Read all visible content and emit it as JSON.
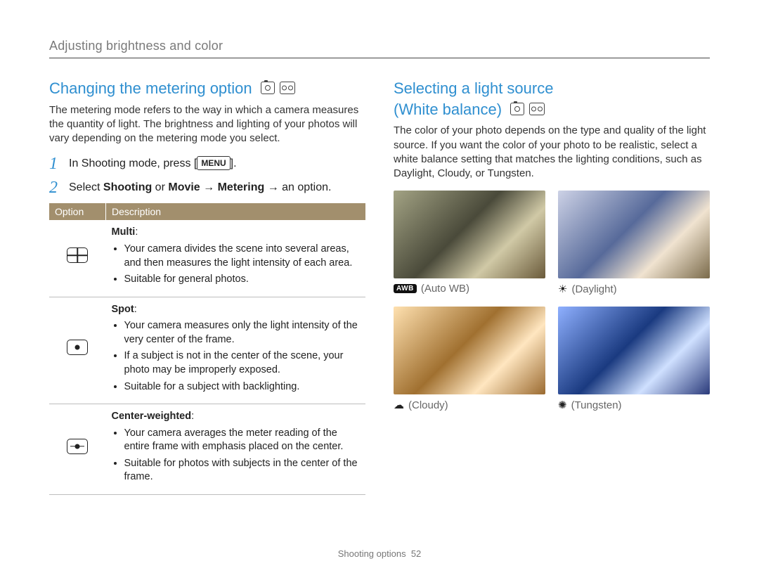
{
  "breadcrumb": "Adjusting brightness and color",
  "left": {
    "title": "Changing the metering option",
    "intro": "The metering mode refers to the way in which a camera measures the quantity of light. The brightness and lighting of your photos will vary depending on the metering mode you select.",
    "steps": {
      "s1_pre": "In Shooting mode, press [",
      "s1_menu": "MENU",
      "s1_post": "].",
      "s2_pre": "Select ",
      "s2_b1": "Shooting",
      "s2_mid1": " or ",
      "s2_b2": "Movie",
      "s2_arrow1": " → ",
      "s2_b3": "Metering",
      "s2_post": " → an option."
    },
    "table": {
      "hdr_option": "Option",
      "hdr_desc": "Description",
      "rows": [
        {
          "icon": "multi",
          "name": "Multi",
          "bullets": [
            "Your camera divides the scene into several areas, and then measures the light intensity of each area.",
            "Suitable for general photos."
          ]
        },
        {
          "icon": "spot",
          "name": "Spot",
          "bullets": [
            "Your camera measures only the light intensity of the very center of the frame.",
            "If a subject is not in the center of the scene, your photo may be improperly exposed.",
            "Suitable for a subject with backlighting."
          ]
        },
        {
          "icon": "center",
          "name": "Center-weighted",
          "bullets": [
            "Your camera averages the meter reading of the entire frame with emphasis placed on the center.",
            "Suitable for photos with subjects in the center of the frame."
          ]
        }
      ]
    }
  },
  "right": {
    "title_l1": "Selecting a light source",
    "title_l2": "(White balance)",
    "intro": "The color of your photo depends on the type and quality of the light source. If you want the color of your photo to be realistic, select a white balance setting that matches the lighting conditions, such as Daylight, Cloudy, or Tungsten.",
    "wb": [
      {
        "key": "auto",
        "label": "(Auto WB)",
        "icon_name": "awb-icon",
        "icon_glyph": "AWB"
      },
      {
        "key": "daylight",
        "label": "(Daylight)",
        "icon_name": "sun-icon",
        "icon_glyph": "☀"
      },
      {
        "key": "cloudy",
        "label": "(Cloudy)",
        "icon_name": "cloud-icon",
        "icon_glyph": "☁"
      },
      {
        "key": "tungsten",
        "label": "(Tungsten)",
        "icon_name": "lightbulb-icon",
        "icon_glyph": "✺"
      }
    ]
  },
  "footer": {
    "section": "Shooting options",
    "page": "52"
  }
}
